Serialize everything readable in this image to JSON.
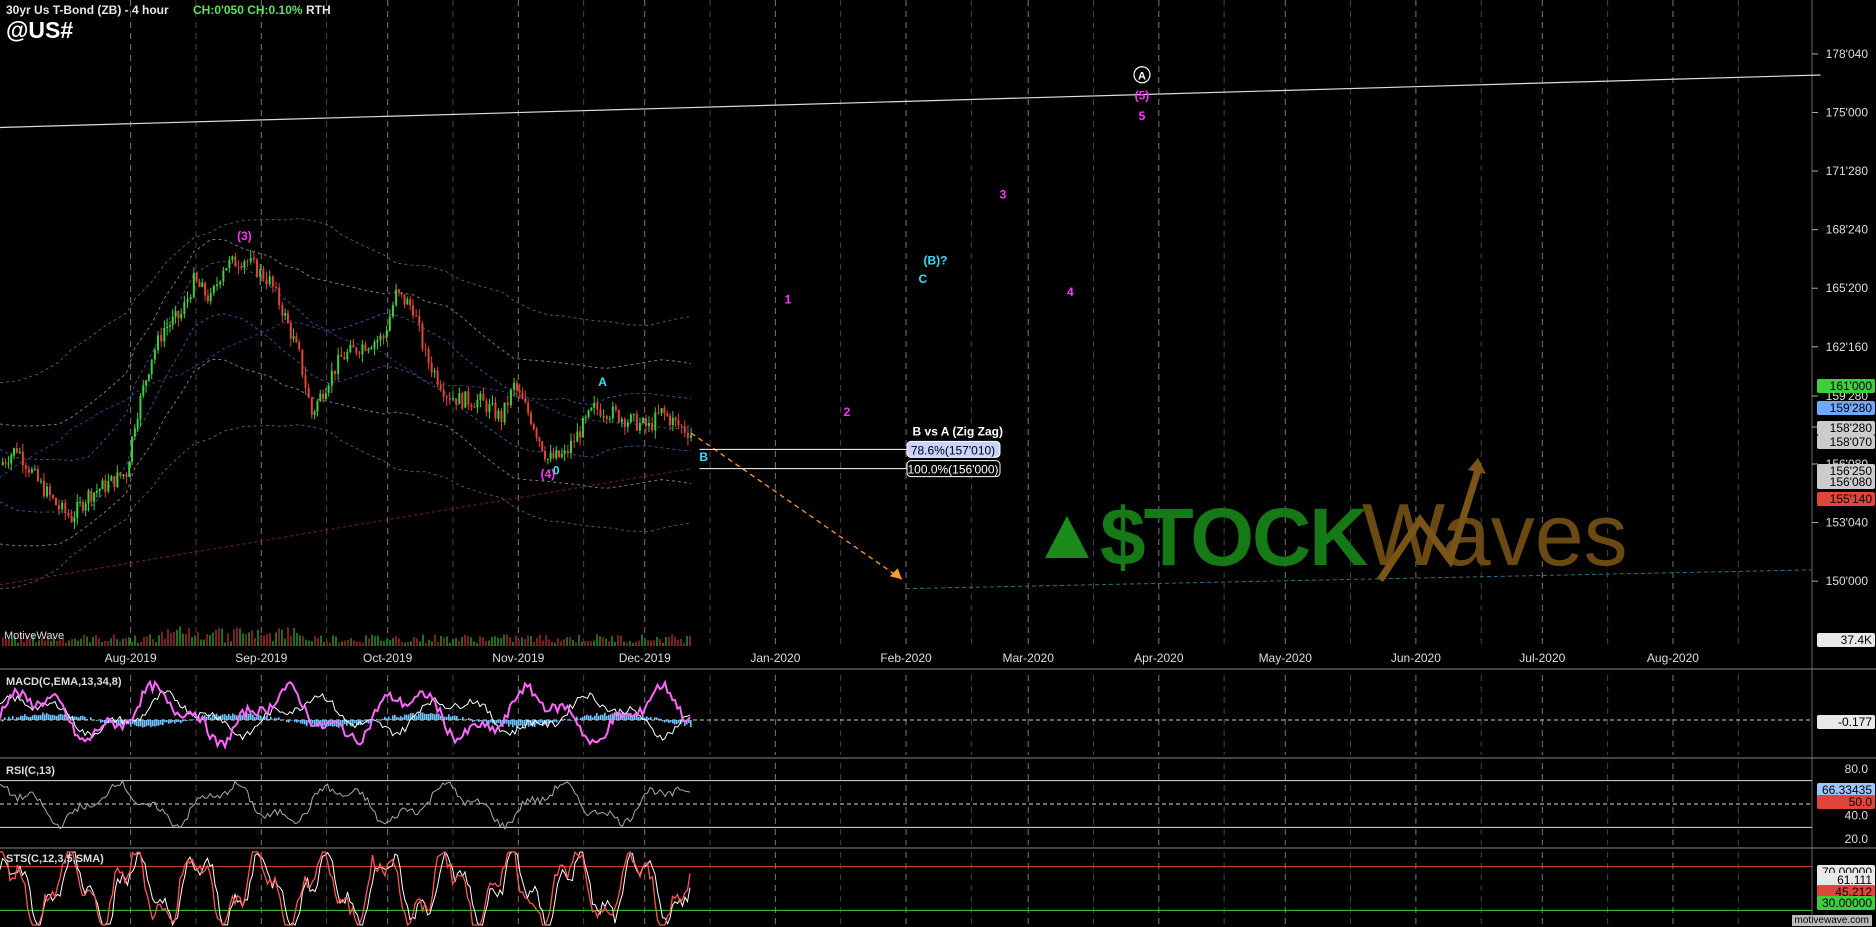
{
  "header": {
    "title": "30yr Us T-Bond (ZB) - 4 hour",
    "change": "CH:0'050 CH:0.10%",
    "session": "RTH",
    "symbol": "@US#"
  },
  "brand": "MotiveWave",
  "watermark": "motivewave.com",
  "logo_text": "$TOCKWaves",
  "colors": {
    "background": "#000000",
    "grid": "#444444",
    "up_candle": "#3ecf3e",
    "down_candle": "#e0453a",
    "wave_magenta": "#ff33ff",
    "wave_cyan": "#33e0ff",
    "fib_line": "#ffffff",
    "projection_arrow": "#ff9a2e",
    "macd_line": "#ff66ff",
    "macd_signal": "#ffffff",
    "macd_hist": "#6fc6ff",
    "rsi_line": "#aaaaaa",
    "stoch_k": "#ff5555",
    "stoch_d": "#ffffff"
  },
  "chart_data": [
    {
      "type": "line",
      "panel": "price",
      "description_scale": "price in points'32nds",
      "x_ticks": [
        "Aug-2019",
        "Sep-2019",
        "Oct-2019",
        "Nov-2019",
        "Dec-2019",
        "Jan-2020",
        "Feb-2020",
        "Mar-2020",
        "Apr-2020",
        "May-2020",
        "Jun-2020",
        "Jul-2020",
        "Aug-2020"
      ],
      "y_ticks": [
        "178'040",
        "175'000",
        "171'280",
        "168'240",
        "165'200",
        "162'160",
        "159'280",
        "158'070",
        "156'080",
        "153'040",
        "150'000"
      ],
      "y_tick_values": [
        178.125,
        175.0,
        171.875,
        168.75,
        165.625,
        162.5,
        159.875,
        158.22,
        156.25,
        153.125,
        150.0
      ],
      "ylim": [
        147.5,
        181.0
      ],
      "price_series": [
        {
          "date": "2019-07-01",
          "value": 156.2
        },
        {
          "date": "2019-07-05",
          "value": 157.1
        },
        {
          "date": "2019-07-10",
          "value": 155.3
        },
        {
          "date": "2019-07-15",
          "value": 153.9
        },
        {
          "date": "2019-07-18",
          "value": 153.4
        },
        {
          "date": "2019-07-22",
          "value": 154.6
        },
        {
          "date": "2019-07-26",
          "value": 155.1
        },
        {
          "date": "2019-07-31",
          "value": 155.8
        },
        {
          "date": "2019-08-02",
          "value": 158.5
        },
        {
          "date": "2019-08-06",
          "value": 162.0
        },
        {
          "date": "2019-08-09",
          "value": 163.5
        },
        {
          "date": "2019-08-13",
          "value": 164.2
        },
        {
          "date": "2019-08-16",
          "value": 166.0
        },
        {
          "date": "2019-08-20",
          "value": 165.0
        },
        {
          "date": "2019-08-23",
          "value": 166.8
        },
        {
          "date": "2019-08-28",
          "value": 167.2
        },
        {
          "date": "2019-09-03",
          "value": 166.0
        },
        {
          "date": "2019-09-06",
          "value": 164.5
        },
        {
          "date": "2019-09-10",
          "value": 162.0
        },
        {
          "date": "2019-09-13",
          "value": 158.9
        },
        {
          "date": "2019-09-17",
          "value": 160.8
        },
        {
          "date": "2019-09-20",
          "value": 161.9
        },
        {
          "date": "2019-09-25",
          "value": 162.6
        },
        {
          "date": "2019-09-30",
          "value": 163.0
        },
        {
          "date": "2019-10-03",
          "value": 165.3
        },
        {
          "date": "2019-10-07",
          "value": 164.6
        },
        {
          "date": "2019-10-10",
          "value": 162.0
        },
        {
          "date": "2019-10-15",
          "value": 160.0
        },
        {
          "date": "2019-10-18",
          "value": 159.7
        },
        {
          "date": "2019-10-23",
          "value": 159.6
        },
        {
          "date": "2019-10-28",
          "value": 158.7
        },
        {
          "date": "2019-10-31",
          "value": 160.4
        },
        {
          "date": "2019-11-04",
          "value": 158.7
        },
        {
          "date": "2019-11-08",
          "value": 156.5
        },
        {
          "date": "2019-11-12",
          "value": 156.7
        },
        {
          "date": "2019-11-15",
          "value": 157.8
        },
        {
          "date": "2019-11-19",
          "value": 159.2
        },
        {
          "date": "2019-11-22",
          "value": 159.1
        },
        {
          "date": "2019-11-27",
          "value": 158.6
        },
        {
          "date": "2019-12-02",
          "value": 158.2
        },
        {
          "date": "2019-12-05",
          "value": 159.0
        },
        {
          "date": "2019-12-09",
          "value": 158.3
        },
        {
          "date": "2019-12-12",
          "value": 157.9
        }
      ],
      "current_price_labels": [
        {
          "text": "161'000",
          "color": "#3ecf3e"
        },
        {
          "text": "159'280",
          "color": "#6fa8ff"
        },
        {
          "text": "158'280",
          "color": "#cccccc"
        },
        {
          "text": "158'070",
          "color": "#cccccc"
        },
        {
          "text": "156'250",
          "color": "#cccccc"
        },
        {
          "text": "156'080",
          "color": "#cccccc"
        },
        {
          "text": "155'140",
          "color": "#e0453a"
        }
      ],
      "volume_label": "37.4K",
      "wave_labels": [
        {
          "text": "(3)",
          "color": "magenta",
          "date": "2019-08-28",
          "value": 168.2
        },
        {
          "text": "(4)",
          "color": "magenta",
          "date": "2019-11-08",
          "value": 155.5
        },
        {
          "text": "0",
          "color": "cyan",
          "date": "2019-11-10",
          "value": 155.7
        },
        {
          "text": "A",
          "color": "cyan",
          "date": "2019-11-21",
          "value": 160.4
        },
        {
          "text": "B",
          "color": "cyan",
          "date": "2019-12-15",
          "value": 156.4
        },
        {
          "text": "1",
          "color": "magenta",
          "date": "2020-01-04",
          "value": 164.8
        },
        {
          "text": "2",
          "color": "magenta",
          "date": "2020-01-18",
          "value": 158.8
        },
        {
          "text": "C",
          "color": "cyan",
          "date": "2020-02-05",
          "value": 165.9
        },
        {
          "text": "(B)?",
          "color": "cyan",
          "date": "2020-02-08",
          "value": 166.9
        },
        {
          "text": "3",
          "color": "magenta",
          "date": "2020-02-24",
          "value": 170.4
        },
        {
          "text": "4",
          "color": "magenta",
          "date": "2020-03-11",
          "value": 165.2
        },
        {
          "text": "(A)",
          "color": "white",
          "date": "2020-03-28",
          "value": 176.8
        },
        {
          "text": "(5)",
          "color": "magenta",
          "date": "2020-03-28",
          "value": 175.7
        },
        {
          "text": "5",
          "color": "magenta",
          "date": "2020-03-28",
          "value": 174.6
        }
      ],
      "fib_title": "B vs A (Zig Zag)",
      "fib_levels": [
        {
          "label": "78.6%(157'010)",
          "value": 157.03,
          "style": "filled"
        },
        {
          "label": "100.0%(156'000)",
          "value": 156.0,
          "style": "outline"
        }
      ],
      "projection": {
        "from": {
          "date": "2019-12-12",
          "value": 157.9
        },
        "to": {
          "date": "2020-01-31",
          "value": 150.1
        }
      },
      "trendline": {
        "from": {
          "date": "2019-07-01",
          "value": 174.2
        },
        "to": {
          "date": "2020-09-05",
          "value": 177.0
        }
      }
    },
    {
      "type": "line",
      "panel": "macd",
      "title": "MACD(C,EMA,13,34,8)",
      "last_value": "-0.177",
      "ylim": [
        -1.6,
        3.2
      ]
    },
    {
      "type": "line",
      "panel": "rsi",
      "title": "RSI(C,13)",
      "y_ticks": [
        "80.0",
        "40.0",
        "20.0"
      ],
      "levels": [
        70,
        50,
        30
      ],
      "last_value": "66.33435",
      "second_value": "50.0",
      "ylim": [
        15,
        85
      ]
    },
    {
      "type": "line",
      "panel": "stoch",
      "title": "STS(C,12,3,5,SMA)",
      "last_values": [
        "70.00000",
        "61.111",
        "45.212",
        "30.00000"
      ],
      "levels": [
        80,
        20
      ],
      "ylim": [
        0,
        100
      ]
    }
  ]
}
